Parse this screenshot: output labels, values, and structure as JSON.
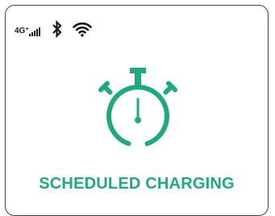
{
  "status_bar": {
    "network_label": "4G",
    "network_superscript": "+",
    "signal_icon": "signal-bars-icon",
    "bluetooth_icon": "bluetooth-icon",
    "wifi_icon": "wifi-icon"
  },
  "main": {
    "icon": "stopwatch-icon",
    "title": "SCHEDULED CHARGING"
  },
  "colors": {
    "accent": "#1fa97f",
    "text_dark": "#1a1a1a",
    "border": "#444444",
    "background": "#ffffff"
  }
}
